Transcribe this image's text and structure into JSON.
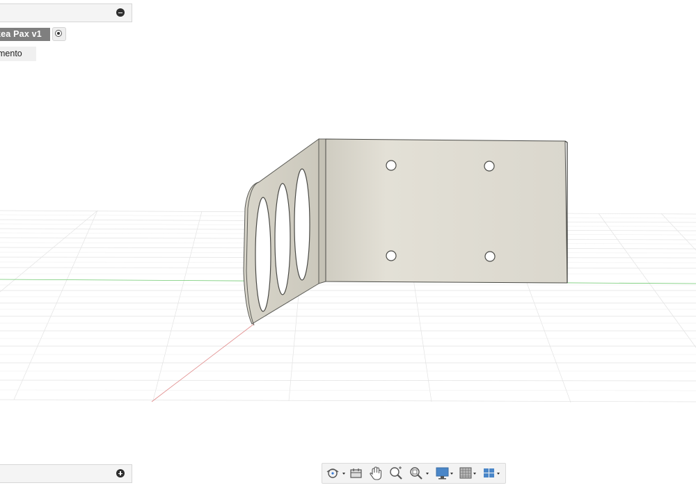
{
  "browser": {
    "component_name": "kea Pax v1",
    "sub_item": "mento"
  },
  "nav_bar": {
    "items": [
      {
        "name": "orbit-icon",
        "dropdown": true
      },
      {
        "name": "look-at-icon",
        "dropdown": false
      },
      {
        "name": "pan-hand-icon",
        "dropdown": false
      },
      {
        "name": "zoom-icon",
        "dropdown": false
      },
      {
        "name": "fit-zoom-icon",
        "dropdown": true
      },
      {
        "name": "display-settings-icon",
        "dropdown": true
      },
      {
        "name": "grid-snaps-icon",
        "dropdown": true
      },
      {
        "name": "viewports-icon",
        "dropdown": true
      }
    ]
  },
  "colors": {
    "part_face": "#dcd9cf",
    "part_edge": "#5a5a55",
    "grid_line": "#e2e2e2",
    "x_axis": "#e08a8a",
    "y_axis": "#6ec96e",
    "toolbar_bg": "#f3f3f3",
    "label_bg": "#7f7f7f"
  }
}
